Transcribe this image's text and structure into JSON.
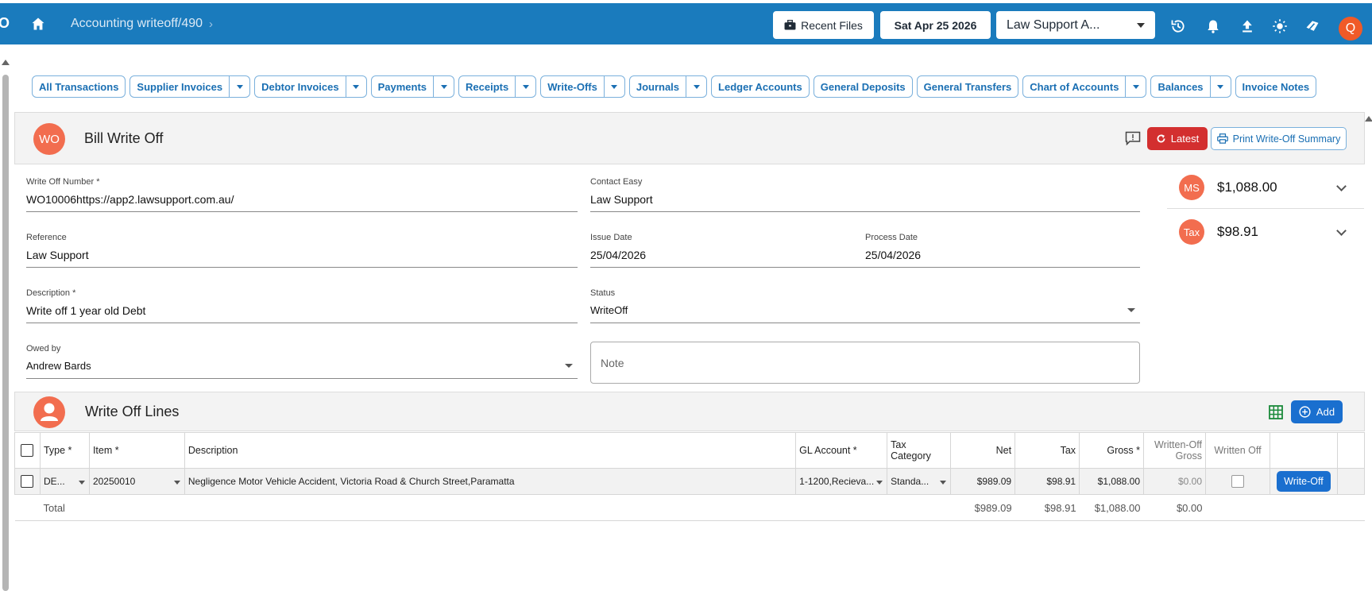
{
  "topbar": {
    "left_fragment": "O",
    "breadcrumb": "Accounting writeoff/490",
    "recent_files": "Recent Files",
    "date": "Sat Apr 25 2026",
    "organisation": "Law Support A...",
    "avatar_letter": "Q"
  },
  "nav": {
    "items": [
      {
        "label": "All Transactions",
        "dropdown": false
      },
      {
        "label": "Supplier Invoices",
        "dropdown": true
      },
      {
        "label": "Debtor Invoices",
        "dropdown": true
      },
      {
        "label": "Payments",
        "dropdown": true
      },
      {
        "label": "Receipts",
        "dropdown": true
      },
      {
        "label": "Write-Offs",
        "dropdown": true
      },
      {
        "label": "Journals",
        "dropdown": true
      },
      {
        "label": "Ledger Accounts",
        "dropdown": false
      },
      {
        "label": "General Deposits",
        "dropdown": false
      },
      {
        "label": "General Transfers",
        "dropdown": false
      },
      {
        "label": "Chart of Accounts",
        "dropdown": true
      },
      {
        "label": "Balances",
        "dropdown": true
      },
      {
        "label": "Invoice Notes",
        "dropdown": false
      }
    ]
  },
  "panel": {
    "avatar": "WO",
    "title": "Bill Write Off",
    "latest_label": "Latest",
    "print_label": "Print Write-Off Summary"
  },
  "form": {
    "write_off_number": {
      "label": "Write Off Number *",
      "value": "WO10006https://app2.lawsupport.com.au/"
    },
    "contact": {
      "label": "Contact Easy",
      "value": "Law Support"
    },
    "reference": {
      "label": "Reference",
      "value": "Law Support"
    },
    "issue_date": {
      "label": "Issue Date",
      "value": "25/04/2026"
    },
    "process_date": {
      "label": "Process Date",
      "value": "25/04/2026"
    },
    "description": {
      "label": "Description *",
      "value": "Write off 1 year old Debt"
    },
    "status": {
      "label": "Status",
      "value": "WriteOff"
    },
    "owed_by": {
      "label": "Owed by",
      "value": "Andrew Bards"
    },
    "note_placeholder": "Note"
  },
  "summary": {
    "ms": {
      "avatar": "MS",
      "amount": "$1,088.00"
    },
    "tax": {
      "avatar": "Tax",
      "amount": "$98.91"
    }
  },
  "lines": {
    "title": "Write Off Lines",
    "add_label": "Add",
    "headers": {
      "type": "Type *",
      "item": "Item *",
      "description": "Description",
      "gl_account": "GL Account *",
      "tax_category": "Tax Category",
      "net": "Net",
      "tax": "Tax",
      "gross": "Gross *",
      "written_off_gross": "Written-Off Gross",
      "written_off": "Written Off"
    },
    "rows": [
      {
        "type": "DE...",
        "item": "20250010",
        "description": "Negligence Motor Vehicle Accident, Victoria Road & Church Street,Paramatta",
        "gl_account": "1-1200,Recieva...",
        "tax_category": "Standa...",
        "net": "$989.09",
        "tax": "$98.91",
        "gross": "$1,088.00",
        "written_off_gross": "$0.00",
        "action": "Write-Off"
      }
    ],
    "total": {
      "label": "Total",
      "net": "$989.09",
      "tax": "$98.91",
      "gross": "$1,088.00",
      "written_off_gross": "$0.00"
    }
  },
  "colors": {
    "topbar": "#1a7bbd",
    "accent": "#1a6fcf",
    "danger": "#d32f2f",
    "avatar": "#f26d4f",
    "user_avatar": "#f05a28"
  }
}
